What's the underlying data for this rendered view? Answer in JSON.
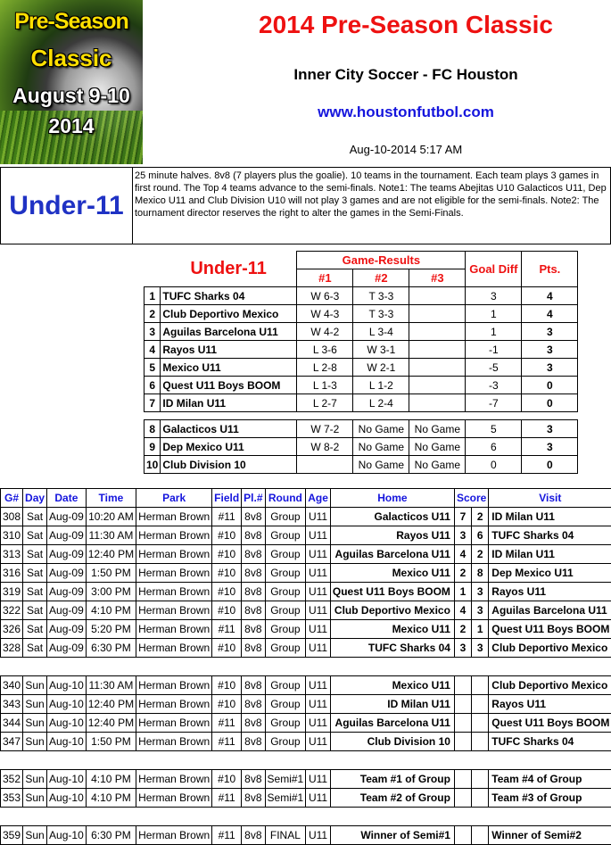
{
  "logo": {
    "line1": "Pre-Season",
    "line2": "Classic",
    "line3": "August  9-10",
    "line4": "2014"
  },
  "header": {
    "title": "2014 Pre-Season Classic",
    "subtitle": "Inner City Soccer  -  FC Houston",
    "url": "www.houstonfutbol.com",
    "timestamp": "Aug-10-2014 5:17 AM"
  },
  "intro": {
    "age_group": "Under-11",
    "notes": "25 minute halves.  8v8 (7 players plus the goalie).  10 teams in the tournament.    Each team plays 3 games in first round.  The Top 4 teams advance to the semi-finals.  Note1: The teams Abejitas U10 Galacticos U11, Dep Mexico U11 and Club Division U10 will not play 3 games and are not eligible for the semi-finals.  Note2: The tournament director reserves the right to alter the games in the Semi-Finals."
  },
  "standings": {
    "title": "Under-11",
    "game_results_label": "Game-Results",
    "col1": "#1",
    "col2": "#2",
    "col3": "#3",
    "goal_diff_label": "Goal Diff",
    "points_label": "Pts.",
    "group_a": [
      {
        "rank": "1",
        "team": "TUFC Sharks 04",
        "g1": "W 6-3",
        "g2": "T 3-3",
        "g3": "",
        "gd": "3",
        "pts": "4"
      },
      {
        "rank": "2",
        "team": "Club Deportivo Mexico",
        "g1": "W 4-3",
        "g2": "T 3-3",
        "g3": "",
        "gd": "1",
        "pts": "4"
      },
      {
        "rank": "3",
        "team": "Aguilas Barcelona U11",
        "g1": "W 4-2",
        "g2": "L 3-4",
        "g3": "",
        "gd": "1",
        "pts": "3"
      },
      {
        "rank": "4",
        "team": "Rayos U11",
        "g1": "L 3-6",
        "g2": "W 3-1",
        "g3": "",
        "gd": "-1",
        "pts": "3"
      },
      {
        "rank": "5",
        "team": "Mexico U11",
        "g1": "L 2-8",
        "g2": "W 2-1",
        "g3": "",
        "gd": "-5",
        "pts": "3"
      },
      {
        "rank": "6",
        "team": "Quest U11 Boys BOOM",
        "g1": "L 1-3",
        "g2": "L 1-2",
        "g3": "",
        "gd": "-3",
        "pts": "0"
      },
      {
        "rank": "7",
        "team": "ID Milan U11",
        "g1": "L 2-7",
        "g2": "L 2-4",
        "g3": "",
        "gd": "-7",
        "pts": "0"
      }
    ],
    "group_b": [
      {
        "rank": "8",
        "team": "Galacticos U11",
        "g1": "W 7-2",
        "g2": "No Game",
        "g3": "No Game",
        "gd": "5",
        "pts": "3"
      },
      {
        "rank": "9",
        "team": "Dep Mexico U11",
        "g1": "W 8-2",
        "g2": "No Game",
        "g3": "No Game",
        "gd": "6",
        "pts": "3"
      },
      {
        "rank": "10",
        "team": "Club Division 10",
        "g1": "",
        "g2": "No Game",
        "g3": "No Game",
        "gd": "0",
        "pts": "0"
      }
    ]
  },
  "schedule": {
    "headers": {
      "game": "G#",
      "day": "Day",
      "date": "Date",
      "time": "Time",
      "park": "Park",
      "field": "Field",
      "players": "Pl.#",
      "round": "Round",
      "age": "Age",
      "home": "Home",
      "score": "Score",
      "visit": "Visit"
    },
    "blocks": [
      [
        {
          "g": "308",
          "day": "Sat",
          "date": "Aug-09",
          "time": "10:20 AM",
          "park": "Herman Brown",
          "field": "#11",
          "pl": "8v8",
          "round": "Group",
          "age": "U11",
          "home": "Galacticos U11",
          "hs": "7",
          "vs": "2",
          "visit": "ID Milan U11"
        },
        {
          "g": "310",
          "day": "Sat",
          "date": "Aug-09",
          "time": "11:30 AM",
          "park": "Herman Brown",
          "field": "#10",
          "pl": "8v8",
          "round": "Group",
          "age": "U11",
          "home": "Rayos U11",
          "hs": "3",
          "vs": "6",
          "visit": "TUFC Sharks 04"
        },
        {
          "g": "313",
          "day": "Sat",
          "date": "Aug-09",
          "time": "12:40 PM",
          "park": "Herman Brown",
          "field": "#10",
          "pl": "8v8",
          "round": "Group",
          "age": "U11",
          "home": "Aguilas Barcelona U11",
          "hs": "4",
          "vs": "2",
          "visit": "ID Milan U11"
        },
        {
          "g": "316",
          "day": "Sat",
          "date": "Aug-09",
          "time": "1:50 PM",
          "park": "Herman Brown",
          "field": "#10",
          "pl": "8v8",
          "round": "Group",
          "age": "U11",
          "home": "Mexico U11",
          "hs": "2",
          "vs": "8",
          "visit": "Dep Mexico U11"
        },
        {
          "g": "319",
          "day": "Sat",
          "date": "Aug-09",
          "time": "3:00 PM",
          "park": "Herman Brown",
          "field": "#10",
          "pl": "8v8",
          "round": "Group",
          "age": "U11",
          "home": "Quest U11 Boys BOOM",
          "hs": "1",
          "vs": "3",
          "visit": "Rayos U11"
        },
        {
          "g": "322",
          "day": "Sat",
          "date": "Aug-09",
          "time": "4:10 PM",
          "park": "Herman Brown",
          "field": "#10",
          "pl": "8v8",
          "round": "Group",
          "age": "U11",
          "home": "Club Deportivo Mexico",
          "hs": "4",
          "vs": "3",
          "visit": "Aguilas Barcelona U11"
        },
        {
          "g": "326",
          "day": "Sat",
          "date": "Aug-09",
          "time": "5:20 PM",
          "park": "Herman Brown",
          "field": "#11",
          "pl": "8v8",
          "round": "Group",
          "age": "U11",
          "home": "Mexico U11",
          "hs": "2",
          "vs": "1",
          "visit": "Quest U11 Boys BOOM"
        },
        {
          "g": "328",
          "day": "Sat",
          "date": "Aug-09",
          "time": "6:30 PM",
          "park": "Herman Brown",
          "field": "#10",
          "pl": "8v8",
          "round": "Group",
          "age": "U11",
          "home": "TUFC Sharks 04",
          "hs": "3",
          "vs": "3",
          "visit": "Club Deportivo Mexico"
        }
      ],
      [
        {
          "g": "340",
          "day": "Sun",
          "date": "Aug-10",
          "time": "11:30 AM",
          "park": "Herman Brown",
          "field": "#10",
          "pl": "8v8",
          "round": "Group",
          "age": "U11",
          "home": "Mexico U11",
          "hs": "",
          "vs": "",
          "visit": "Club Deportivo Mexico"
        },
        {
          "g": "343",
          "day": "Sun",
          "date": "Aug-10",
          "time": "12:40 PM",
          "park": "Herman Brown",
          "field": "#10",
          "pl": "8v8",
          "round": "Group",
          "age": "U11",
          "home": "ID Milan U11",
          "hs": "",
          "vs": "",
          "visit": "Rayos U11"
        },
        {
          "g": "344",
          "day": "Sun",
          "date": "Aug-10",
          "time": "12:40 PM",
          "park": "Herman Brown",
          "field": "#11",
          "pl": "8v8",
          "round": "Group",
          "age": "U11",
          "home": "Aguilas Barcelona U11",
          "hs": "",
          "vs": "",
          "visit": "Quest U11 Boys BOOM"
        },
        {
          "g": "347",
          "day": "Sun",
          "date": "Aug-10",
          "time": "1:50 PM",
          "park": "Herman Brown",
          "field": "#11",
          "pl": "8v8",
          "round": "Group",
          "age": "U11",
          "home": "Club Division 10",
          "hs": "",
          "vs": "",
          "visit": "TUFC Sharks 04"
        }
      ],
      [
        {
          "g": "352",
          "day": "Sun",
          "date": "Aug-10",
          "time": "4:10 PM",
          "park": "Herman Brown",
          "field": "#10",
          "pl": "8v8",
          "round": "Semi#1",
          "age": "U11",
          "home": "Team #1 of Group",
          "hs": "",
          "vs": "",
          "visit": "Team #4 of Group"
        },
        {
          "g": "353",
          "day": "Sun",
          "date": "Aug-10",
          "time": "4:10 PM",
          "park": "Herman Brown",
          "field": "#11",
          "pl": "8v8",
          "round": "Semi#1",
          "age": "U11",
          "home": "Team #2 of Group",
          "hs": "",
          "vs": "",
          "visit": "Team #3 of Group"
        }
      ],
      [
        {
          "g": "359",
          "day": "Sun",
          "date": "Aug-10",
          "time": "6:30 PM",
          "park": "Herman Brown",
          "field": "#11",
          "pl": "8v8",
          "round": "FINAL",
          "age": "U11",
          "home": "Winner of Semi#1",
          "hs": "",
          "vs": "",
          "visit": "Winner of Semi#2"
        }
      ]
    ]
  }
}
